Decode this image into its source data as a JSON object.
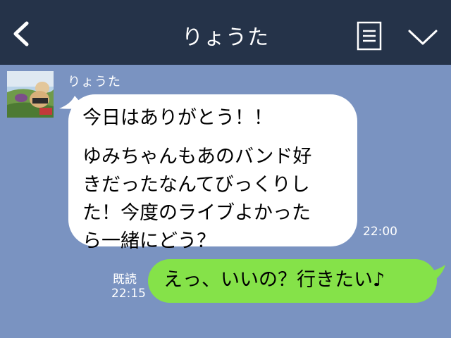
{
  "header": {
    "title": "りょうた",
    "back_icon": "chevron-left-icon",
    "menu_icon": "menu-list-icon",
    "collapse_icon": "chevron-down-icon"
  },
  "colors": {
    "header_bg": "#253349",
    "chat_bg": "#7a93c1",
    "incoming_bubble": "#ffffff",
    "outgoing_bubble": "#85e249"
  },
  "messages": [
    {
      "direction": "incoming",
      "sender": "りょうた",
      "lines": [
        "今日はありがとう！！",
        "",
        "ゆみちゃんもあのバンド好",
        "きだったなんてびっくりし",
        "た！今度のライブよかった",
        "ら一緒にどう？"
      ],
      "time": "22:00"
    },
    {
      "direction": "outgoing",
      "text": "えっ、いいの？行きたい♪",
      "read_label": "既読",
      "time": "22:15"
    }
  ]
}
